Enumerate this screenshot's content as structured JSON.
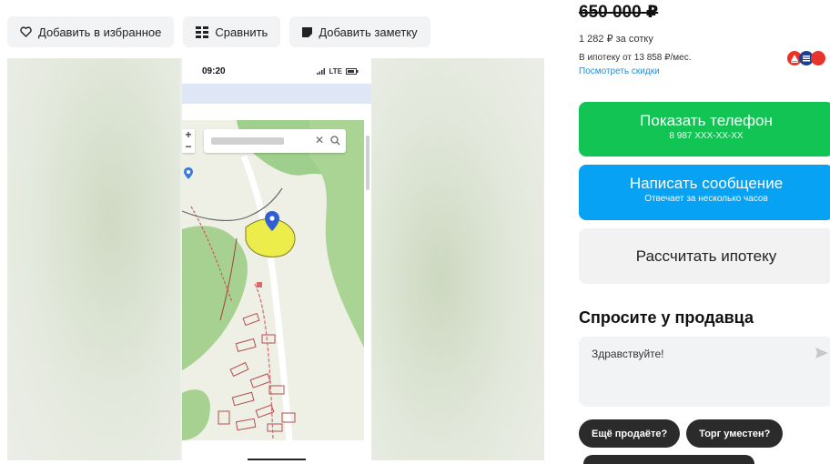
{
  "toolbar": {
    "favorite_label": "Добавить в избранное",
    "compare_label": "Сравнить",
    "note_label": "Добавить заметку"
  },
  "gallery": {
    "phone_time": "09:20",
    "phone_status_icons": "LTE"
  },
  "price": {
    "old_price": "650 000 ₽",
    "per_sotka": "1 282 ₽ за сотку",
    "mortgage": "В ипотеку от 13 858 ₽/мес.",
    "discounts_link": "Посмотреть скидки"
  },
  "actions": {
    "phone_label": "Показать телефон",
    "phone_number": "8 987 XXX-XX-XX",
    "message_label": "Написать сообщение",
    "message_sub": "Отвечает за несколько часов",
    "mortgage_label": "Рассчитать ипотеку"
  },
  "ask": {
    "heading": "Спросите у продавца",
    "message": "Здравствуйте!",
    "chips": [
      "Ещё продаёте?",
      "Торг уместен?"
    ]
  },
  "colors": {
    "green": "#12c453",
    "blue": "#08a2f5",
    "link": "#1c8ee0"
  }
}
